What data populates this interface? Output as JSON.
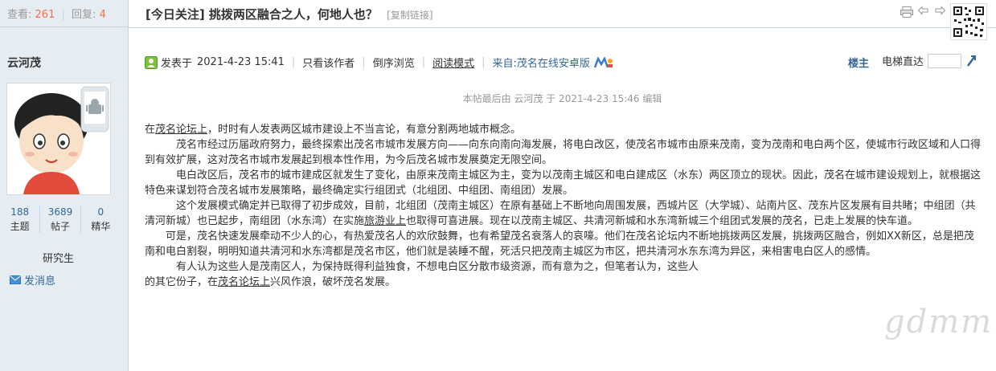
{
  "sidebar": {
    "views_label": "查看:",
    "views_count": "261",
    "divider": "|",
    "replies_label": "回复:",
    "replies_count": "4",
    "author": "云河茂",
    "stats": [
      {
        "value": "188",
        "label": "主题"
      },
      {
        "value": "3689",
        "label": "帖子"
      },
      {
        "value": "0",
        "label": "精华"
      }
    ],
    "rank": "研究生",
    "send_message": "发消息"
  },
  "thread": {
    "title": "[今日关注] 挑拨两区融合之人，何地人也？",
    "copy_link": "[复制链接]"
  },
  "post": {
    "posted_label": "发表于",
    "posted_time": "2021-4-23 15:41",
    "sep": "|",
    "author_only": "只看该作者",
    "reverse": "倒序浏览",
    "read_mode": "阅读模式",
    "source": "来自:茂名在线安卓版",
    "floor": "楼主",
    "jump_label": "电梯直达",
    "edited_note": "本帖最后由 云河茂 于 2021-4-23 15:46 编辑",
    "paragraphs": {
      "p1_a": "在",
      "p1_link": "茂名论坛上",
      "p1_b": "，时时有人发表两区城市建设上不当言论，有意分割两地城市概念。",
      "p2": "　　　茂名市经过历届政府努力，最终探索出茂名市城市发展方向——向东向南向海发展，将电白改区，使茂名市城市由原来茂南，变为茂南和电白两个区，使城市行政区域和人口得到有效扩展，这对茂名市城市发展起到根本性作用，为今后茂名城市发展奠定无限空间。",
      "p3": "　　　电白改区后，茂名市的城市建成区就发生了变化，由原来茂南主城区为主，变为以茂南主城区和电白建成区（水东）两区顶立的现状。因此，茂名在城市建设规划上，就根据这特色来谋划符合茂名城市发展策略，最终确定实行组团式（北组团、中组团、南组团）发展。",
      "p4_a": "　　　这个发展模式确定并已取得了初步成效，目前，北组团（茂南主城区）在原有基础上不断地向周围发展，西城片区（大学城）、站南片区、茂东片区发展有目共睹；中组团（共清河新城）也已起步，南组团（水东湾）在实施",
      "p4_link": "旅游业上",
      "p4_b": "也取得可喜进展。现在以茂南主城区、共清河新城和水东湾新城三个组团式发展的茂名，已走上发展的快车道。",
      "p5": "　　可是，茂名快速发展牵动不少人的心，有热爱茂名人的欢欣鼓舞，也有希望茂名衰落人的哀嚎。他们在茂名论坛内不断地挑拨两区发展，挑拨两区融合，例如XX新区，总是把茂南和电白割裂，明明知道共清河和水东湾都是茂名市区，他们就是装睡不醒，死活只把茂南主城区为市区，把共清河水东东湾为异区，来相害电白区人的感情。",
      "p6_a": "　　　有人认为这些人是茂南区人，为保持既得利益独食，不想电白区分散市级资源，而有意为之，但笔者认为，这些人",
      "p6_b": "的其它份子，在",
      "p6_link": "茂名论坛上",
      "p6_c": "兴风作浪，破坏茂名发展。"
    }
  },
  "watermark": "gdmm.com",
  "colors": {
    "accent": "#336699",
    "count": "#f26c4f",
    "sidebar_bg": "#e5edf2",
    "border": "#c2d5e3"
  }
}
